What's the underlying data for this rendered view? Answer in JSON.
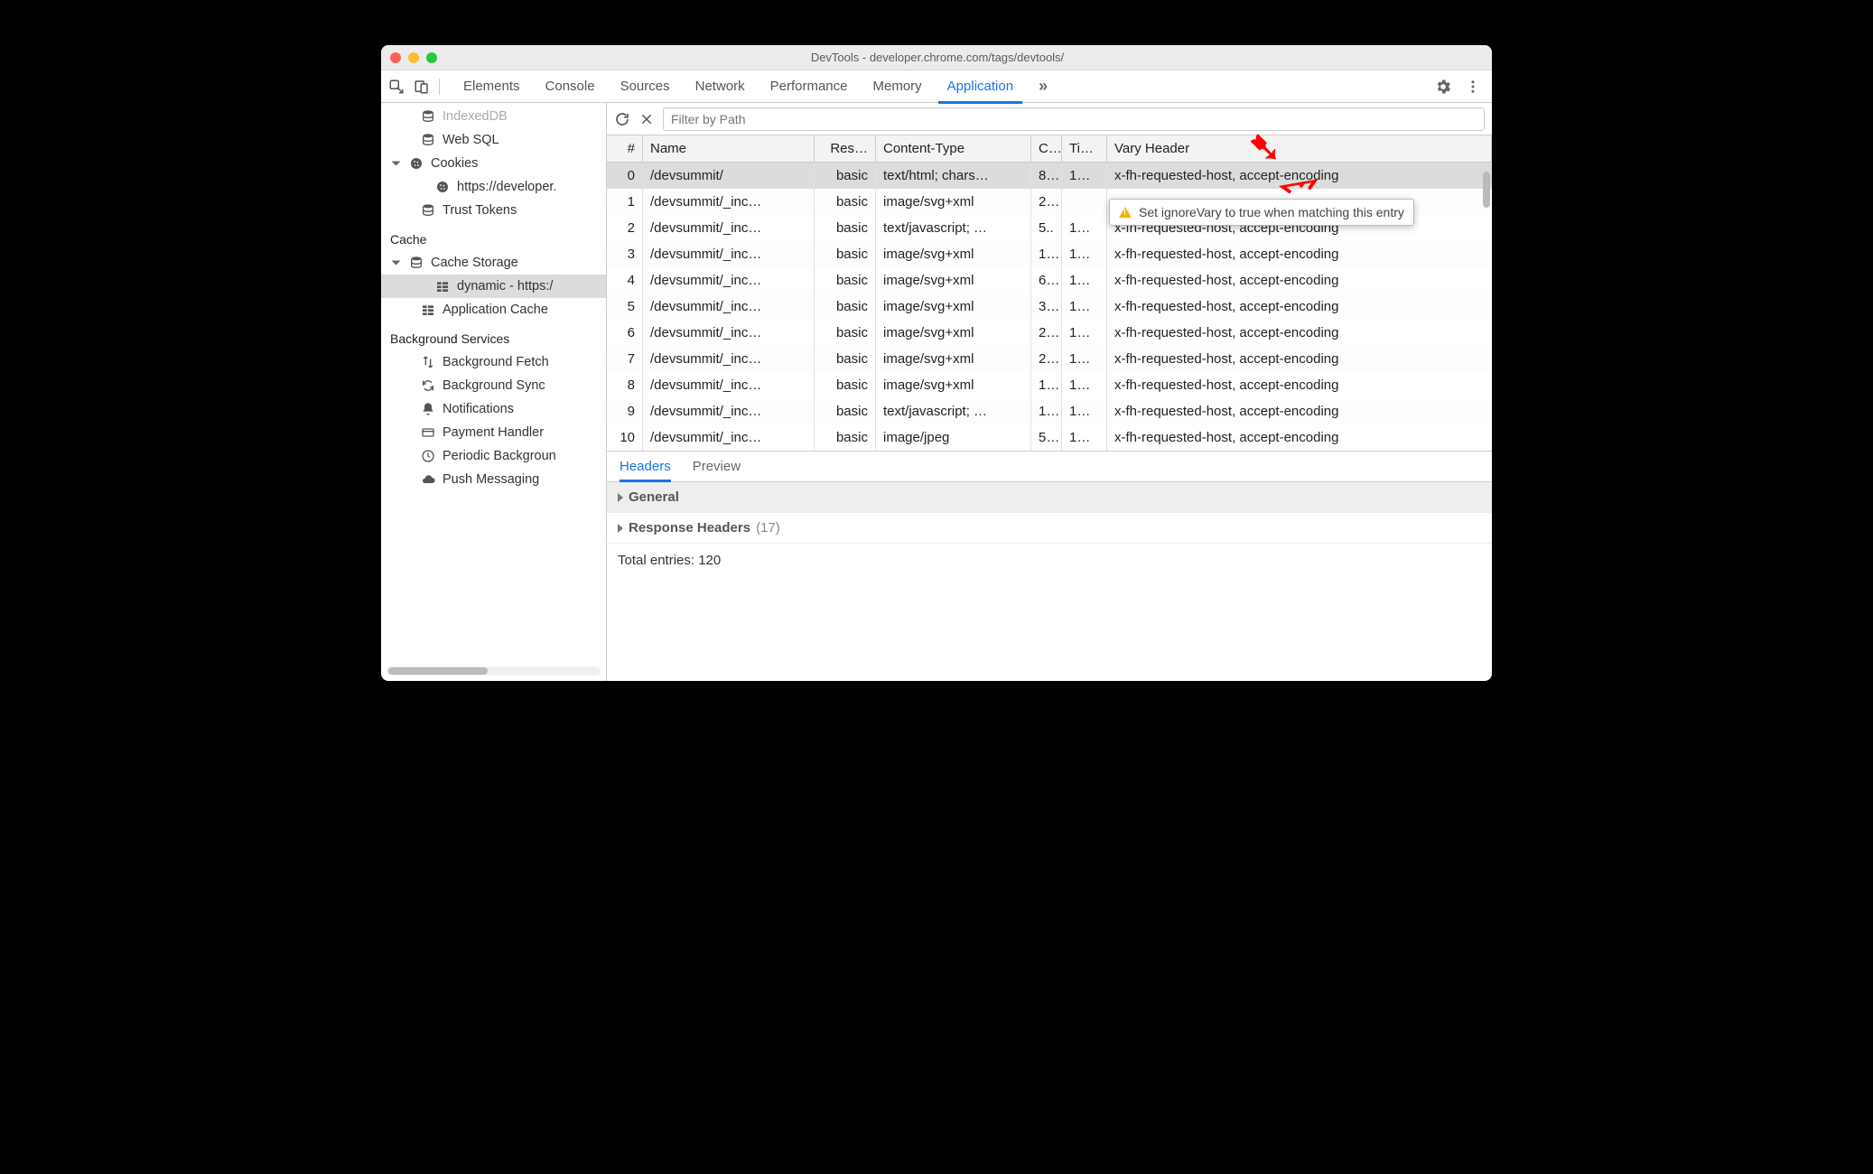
{
  "window": {
    "title": "DevTools - developer.chrome.com/tags/devtools/"
  },
  "tabs": {
    "items": [
      "Elements",
      "Console",
      "Sources",
      "Network",
      "Performance",
      "Memory",
      "Application"
    ],
    "active": "Application",
    "overflow": "»"
  },
  "sidebar": {
    "groups": [
      {
        "items": [
          {
            "icon": "db",
            "label": "IndexedDB",
            "level": 2,
            "dim": true
          },
          {
            "icon": "db",
            "label": "Web SQL",
            "level": 2
          },
          {
            "icon": "cookie",
            "label": "Cookies",
            "level": 1,
            "expandable": true
          },
          {
            "icon": "cookie",
            "label": "https://developer.",
            "level": 3
          },
          {
            "icon": "db",
            "label": "Trust Tokens",
            "level": 2
          }
        ]
      },
      {
        "title": "Cache",
        "items": [
          {
            "icon": "db",
            "label": "Cache Storage",
            "level": 1,
            "expandable": true
          },
          {
            "icon": "grid",
            "label": "dynamic - https:/",
            "level": 3,
            "selected": true
          },
          {
            "icon": "grid",
            "label": "Application Cache",
            "level": 2
          }
        ]
      },
      {
        "title": "Background Services",
        "items": [
          {
            "icon": "updown",
            "label": "Background Fetch",
            "level": 2
          },
          {
            "icon": "sync",
            "label": "Background Sync",
            "level": 2
          },
          {
            "icon": "bell",
            "label": "Notifications",
            "level": 2
          },
          {
            "icon": "card",
            "label": "Payment Handler",
            "level": 2
          },
          {
            "icon": "clock",
            "label": "Periodic Backgroun",
            "level": 2
          },
          {
            "icon": "cloud",
            "label": "Push Messaging",
            "level": 2
          }
        ]
      }
    ]
  },
  "filter": {
    "placeholder": "Filter by Path"
  },
  "table": {
    "headers": {
      "idx": "#",
      "name": "Name",
      "res": "Res…",
      "ct": "Content-Type",
      "c": "C..",
      "ti": "Ti…",
      "vary": "Vary Header"
    },
    "rows": [
      {
        "idx": "0",
        "name": "/devsummit/",
        "res": "basic",
        "ct": "text/html; chars…",
        "c": "8…",
        "ti": "1…",
        "vary": "x-fh-requested-host, accept-encoding",
        "selected": true
      },
      {
        "idx": "1",
        "name": "/devsummit/_inc…",
        "res": "basic",
        "ct": "image/svg+xml",
        "c": "2…",
        "ti": "",
        "vary": ""
      },
      {
        "idx": "2",
        "name": "/devsummit/_inc…",
        "res": "basic",
        "ct": "text/javascript; …",
        "c": "5..",
        "ti": "1…",
        "vary": "x-fh-requested-host, accept-encoding"
      },
      {
        "idx": "3",
        "name": "/devsummit/_inc…",
        "res": "basic",
        "ct": "image/svg+xml",
        "c": "1…",
        "ti": "1…",
        "vary": "x-fh-requested-host, accept-encoding"
      },
      {
        "idx": "4",
        "name": "/devsummit/_inc…",
        "res": "basic",
        "ct": "image/svg+xml",
        "c": "6…",
        "ti": "1…",
        "vary": "x-fh-requested-host, accept-encoding"
      },
      {
        "idx": "5",
        "name": "/devsummit/_inc…",
        "res": "basic",
        "ct": "image/svg+xml",
        "c": "3…",
        "ti": "1…",
        "vary": "x-fh-requested-host, accept-encoding"
      },
      {
        "idx": "6",
        "name": "/devsummit/_inc…",
        "res": "basic",
        "ct": "image/svg+xml",
        "c": "2…",
        "ti": "1…",
        "vary": "x-fh-requested-host, accept-encoding"
      },
      {
        "idx": "7",
        "name": "/devsummit/_inc…",
        "res": "basic",
        "ct": "image/svg+xml",
        "c": "2…",
        "ti": "1…",
        "vary": "x-fh-requested-host, accept-encoding"
      },
      {
        "idx": "8",
        "name": "/devsummit/_inc…",
        "res": "basic",
        "ct": "image/svg+xml",
        "c": "1…",
        "ti": "1…",
        "vary": "x-fh-requested-host, accept-encoding"
      },
      {
        "idx": "9",
        "name": "/devsummit/_inc…",
        "res": "basic",
        "ct": "text/javascript; …",
        "c": "1…",
        "ti": "1…",
        "vary": "x-fh-requested-host, accept-encoding"
      },
      {
        "idx": "10",
        "name": "/devsummit/_inc…",
        "res": "basic",
        "ct": "image/jpeg",
        "c": "5…",
        "ti": "1…",
        "vary": "x-fh-requested-host, accept-encoding"
      }
    ]
  },
  "tooltip": {
    "text": "Set ignoreVary to true when matching this entry"
  },
  "detail": {
    "tabs": [
      "Headers",
      "Preview"
    ],
    "active": "Headers",
    "general": "General",
    "response": "Response Headers",
    "response_count": "(17)",
    "total": "Total entries: 120"
  }
}
